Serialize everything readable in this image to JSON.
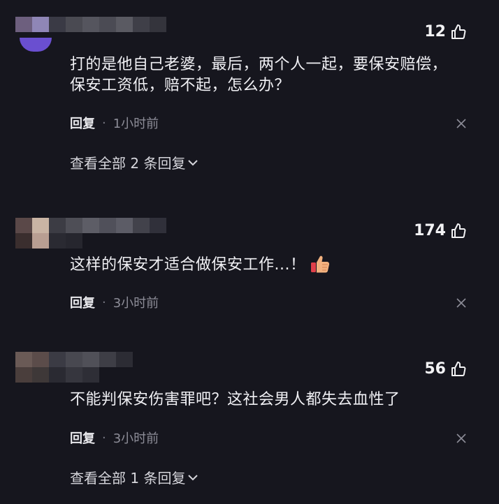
{
  "comments": [
    {
      "likes": "12",
      "text": "打的是他自己老婆，最后，两个人一起，要保安赔偿，保安工资低，赔不起，怎么办？",
      "reply_label": "回复",
      "time": "1小时前",
      "expand_label": "查看全部 2 条回复"
    },
    {
      "likes": "174",
      "text": "这样的保安才适合做保安工作...！",
      "reply_label": "回复",
      "time": "3小时前"
    },
    {
      "likes": "56",
      "text": "不能判保安伤害罪吧？这社会男人都失去血性了",
      "reply_label": "回复",
      "time": "3小时前",
      "expand_label": "查看全部 1 条回复"
    }
  ],
  "icons": {
    "like": "thumbs-up-icon",
    "close": "close-icon",
    "expand": "chevron-down-icon",
    "emoji": "thumbs-up-emoji"
  },
  "colors": {
    "background": "#16161e",
    "text": "#f0f0f4",
    "muted": "#8d8d98"
  }
}
